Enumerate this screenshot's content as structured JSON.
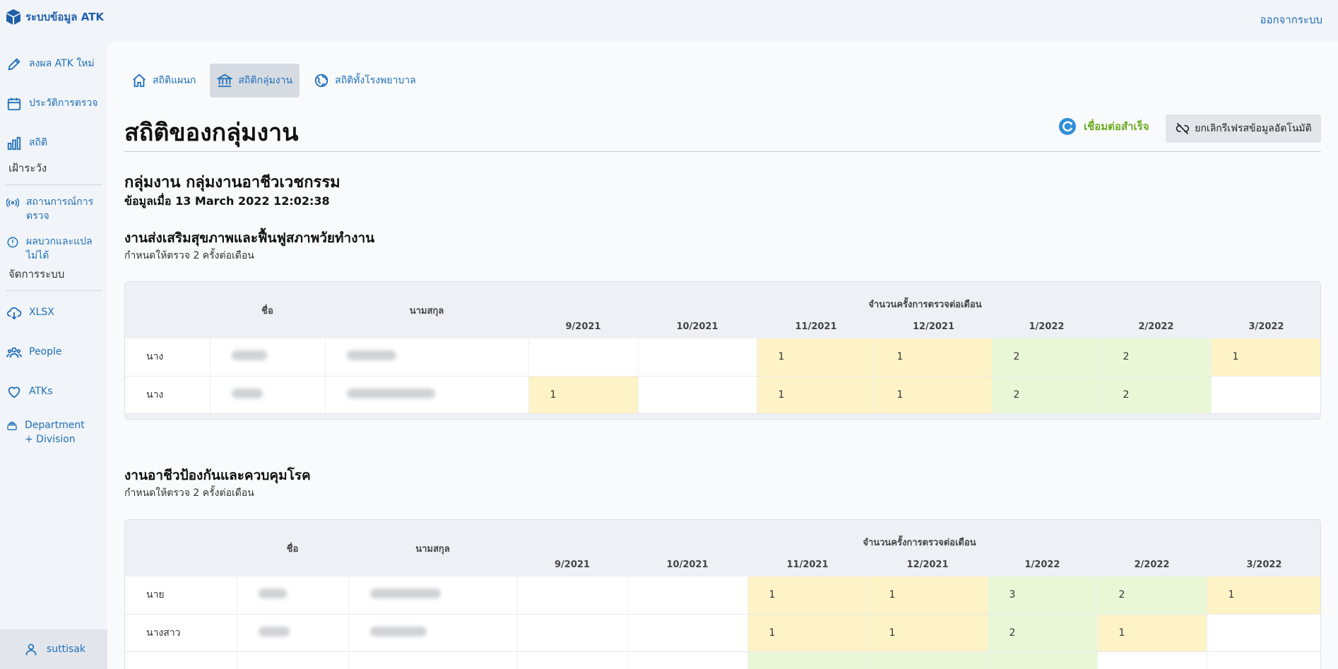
{
  "app": {
    "title": "ระบบข้อมูล ATK",
    "logout": "ออกจากระบบ"
  },
  "sidebar": {
    "items": [
      {
        "label": "ลงผล ATK ใหม่",
        "icon": "pencil-icon"
      },
      {
        "label": "ประวัติการตรวจ",
        "icon": "calendar-icon"
      },
      {
        "label": "สถิติ",
        "icon": "bar-chart-icon"
      },
      {
        "label": "สถานการณ์การตรวจ",
        "icon": "broadcast-icon"
      },
      {
        "label": "ผลบวกและแปลไม่ได้",
        "icon": "alert-circle-icon"
      },
      {
        "label": "XLSX",
        "icon": "cloud-download-icon"
      },
      {
        "label": "People",
        "icon": "people-icon"
      },
      {
        "label": "ATKs",
        "icon": "heart-icon"
      },
      {
        "label": "Department + Division",
        "icon": "stack-icon"
      }
    ],
    "sections": {
      "watch": "เฝ้าระวัง",
      "admin": "จัดการระบบ"
    },
    "user": "suttisak"
  },
  "tabs": [
    {
      "label": "สถิติแผนก",
      "icon": "home-icon"
    },
    {
      "label": "สถิติกลุ่มงาน",
      "icon": "bank-icon"
    },
    {
      "label": "สถิติทั้งโรงพยาบาล",
      "icon": "globe-icon"
    }
  ],
  "header": {
    "title": "สถิติของกลุ่มงาน",
    "status": "เชื่อมต่อสำเร็จ",
    "refresh_button": "ยกเลิกรีเฟรสข้อมูลอัตโนมัติ"
  },
  "group": {
    "title": "กลุ่มงาน กลุ่มงานอาชีวเวชกรรม",
    "data_time": "ข้อมูลเมื่อ 13 March 2022 12:02:38"
  },
  "table_headers": {
    "first_name": "ชื่อ",
    "last_name": "นามสกุล",
    "monthly": "จำนวนครั้งการตรวจต่อเดือน",
    "months": [
      "9/2021",
      "10/2021",
      "11/2021",
      "12/2021",
      "1/2022",
      "2/2022",
      "3/2022"
    ]
  },
  "sections": [
    {
      "title": "งานส่งเสริมสุขภาพและฟื้นฟูสภาพวัยทำงาน",
      "requirement": "กำหนดให้ตรวจ 2 ครั้งต่อเดือน",
      "rows": [
        {
          "prefix": "นาง",
          "counts": [
            "",
            "",
            "1",
            "1",
            "2",
            "2",
            "1"
          ]
        },
        {
          "prefix": "นาง",
          "counts": [
            "1",
            "",
            "1",
            "1",
            "2",
            "2",
            ""
          ]
        }
      ]
    },
    {
      "title": "งานอาชีวป้องกันและควบคุมโรค",
      "requirement": "กำหนดให้ตรวจ 2 ครั้งต่อเดือน",
      "rows": [
        {
          "prefix": "นาย",
          "counts": [
            "",
            "",
            "1",
            "1",
            "3",
            "2",
            "1"
          ]
        },
        {
          "prefix": "นางสาว",
          "counts": [
            "",
            "",
            "1",
            "1",
            "2",
            "1",
            ""
          ]
        }
      ]
    }
  ]
}
